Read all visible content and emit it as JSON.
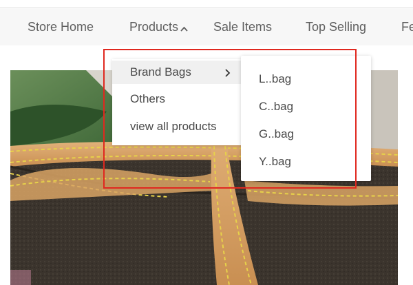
{
  "nav": {
    "items": [
      {
        "label": "Store Home"
      },
      {
        "label": "Products"
      },
      {
        "label": "Sale Items"
      },
      {
        "label": "Top Selling"
      },
      {
        "label": "Fe"
      }
    ]
  },
  "dropdown": {
    "items": [
      {
        "label": "Brand Bags"
      },
      {
        "label": "Others"
      },
      {
        "label": "view all products"
      }
    ]
  },
  "submenu": {
    "items": [
      {
        "label": "L..bag"
      },
      {
        "label": "C..bag"
      },
      {
        "label": "G..bag"
      },
      {
        "label": "Y..bag"
      }
    ]
  },
  "icons": {
    "products_caret": "chevron-up-icon",
    "brand_bags_arrow": "chevron-right-icon"
  },
  "colors": {
    "highlight": "#e0281f",
    "nav_text": "#5f5f5f",
    "menu_text": "#4a4a4a"
  }
}
